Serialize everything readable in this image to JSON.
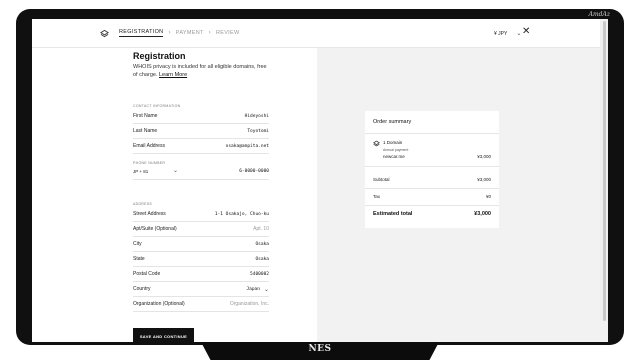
{
  "bezel": {
    "brand_top": "AmdAz",
    "brand_bottom": "NES"
  },
  "header": {
    "steps": [
      "REGISTRATION",
      "PAYMENT",
      "REVIEW"
    ],
    "separator": "›",
    "currency": "¥ JPY",
    "currency_chevron": "⌄",
    "close": "✕"
  },
  "form": {
    "title": "Registration",
    "description": "WHOIS privacy is included for all eligible domains, free of charge.",
    "learn_more": "Learn More",
    "contact_section": "CONTACT INFORMATION",
    "first_name": {
      "label": "First Name",
      "value": "Hideyoshi"
    },
    "last_name": {
      "label": "Last Name",
      "value": "Toyotomi"
    },
    "email": {
      "label": "Email Address",
      "value": "osaka@ampita.net"
    },
    "phone_section": "PHONE NUMBER",
    "phone_country": "JP + 81",
    "phone_value": "6-0000-0000",
    "address_section": "ADDRESS",
    "street": {
      "label": "Street Address",
      "value": "1-1 Osakajo, Chuo-ku"
    },
    "apt": {
      "label": "Apt/Suite (Optional)",
      "placeholder": "Apt. 10"
    },
    "city": {
      "label": "City",
      "value": "Osaka"
    },
    "state": {
      "label": "State",
      "value": "Osaka"
    },
    "postal": {
      "label": "Postal Code",
      "value": "5400002"
    },
    "country": {
      "label": "Country",
      "value": "Japan"
    },
    "organization": {
      "label": "Organization (Optional)",
      "placeholder": "Organization, Inc."
    },
    "submit": "SAVE AND CONTINUE"
  },
  "summary": {
    "title": "Order summary",
    "domain_count": "1 Domain",
    "payment_note": "Annual payment",
    "domain_name": "newcar.me",
    "domain_price": "¥3,000",
    "subtotal_label": "Subtotal",
    "subtotal_value": "¥3,000",
    "tax_label": "Tax",
    "tax_value": "¥0",
    "total_label": "Estimated total",
    "total_value": "¥3,000"
  }
}
